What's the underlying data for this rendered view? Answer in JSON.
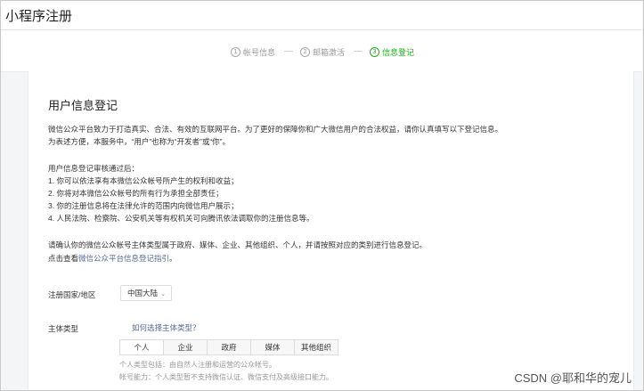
{
  "window": {
    "title": "小程序注册"
  },
  "steps": [
    {
      "num": "1",
      "label": "帐号信息",
      "active": false
    },
    {
      "num": "2",
      "label": "邮箱激活",
      "active": false
    },
    {
      "num": "3",
      "label": "信息登记",
      "active": true
    }
  ],
  "main": {
    "heading": "用户信息登记",
    "intro_1": "微信公众平台致力于打造真实、合法、有效的互联网平台。为了更好的保障你和广大微信用户的合法权益，请你认真填写以下登记信息。",
    "intro_2": "为表述方便，本服务中，“用户”也称为“开发者”或“你”。",
    "after_title": "用户信息登记审核通过后：",
    "after_items": [
      "1. 你可以依法享有本微信公众帐号所产生的权利和收益；",
      "2. 你将对本微信公众帐号的所有行为承担全部责任；",
      "3. 你的注册信息将在法律允许的范围内向微信用户展示；",
      "4. 人民法院、检察院、公安机关等有权机关可向腾讯依法调取你的注册信息等。"
    ],
    "confirm_text": "请确认你的微信公众帐号主体类型属于政府、媒体、企业、其他组织、个人，并请按照对应的类别进行信息登记。",
    "guide_prefix": "点击查看",
    "guide_link": "微信公众平台信息登记指引",
    "guide_suffix": "。"
  },
  "form": {
    "region_label": "注册国家/地区",
    "region_value": "中国大陆",
    "type_label": "主体类型",
    "type_help_link": "如何选择主体类型？",
    "type_tabs": [
      "个人",
      "企业",
      "政府",
      "媒体",
      "其他组织"
    ],
    "type_selected": "个人",
    "note_1": "个人类型包括：由自然人注册和运营的公众帐号。",
    "note_2": "帐号能力：个人类型暂不支持微信认证、微信支付及高级接口能力。"
  },
  "watermark": "CSDN @耶和华的宠儿"
}
